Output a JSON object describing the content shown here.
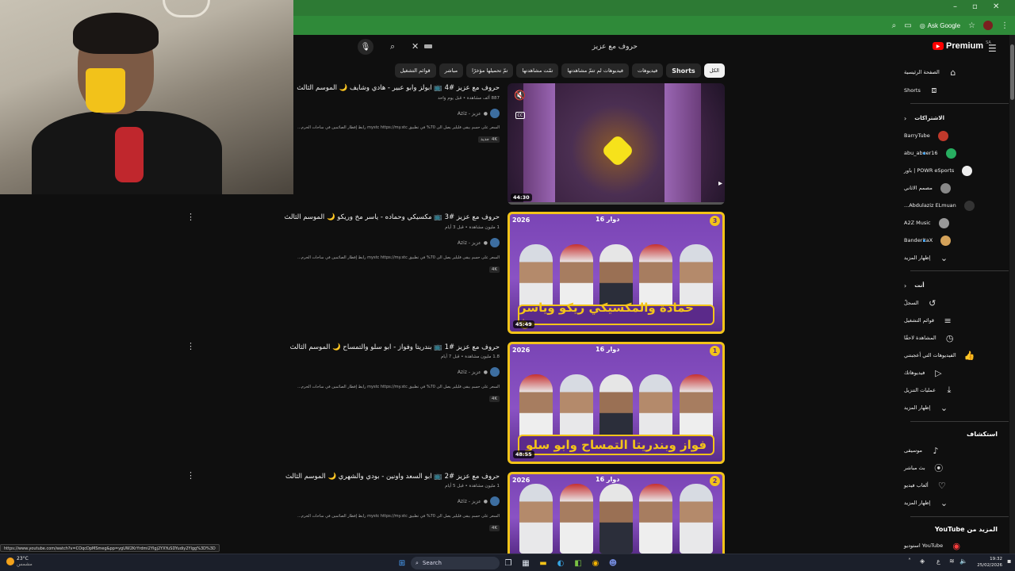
{
  "browser": {
    "ask_google": "Ask Google",
    "window_controls": [
      "–",
      "▫",
      "✕"
    ]
  },
  "search": {
    "query": "حروف مع عزيز"
  },
  "chips": [
    {
      "label": "الكل",
      "active": true
    },
    {
      "label": "Shorts",
      "bold": true
    },
    {
      "label": "فيديوهات"
    },
    {
      "label": "فيديوهات لم تتمّ مشاهدتها"
    },
    {
      "label": "تمّت مشاهدتها"
    },
    {
      "label": "تمّ تحميلها مؤخرًا"
    },
    {
      "label": "مباشر"
    },
    {
      "label": "قوائم التشغيل"
    }
  ],
  "results": [
    {
      "title": "حروف مع عزيز #4 📺 ابولز وابو عبير - هادي وشايف 🌙 الموسم الثالث",
      "meta": "887 ألف مشاهدة • قبل يوم واحد",
      "channel": "Aziz - عزيز",
      "desc": "السعر على حسم يبقى قليلير يصل الى 70% في تطبيق mystc https://my.stc رابط إفطار الصائمين في ساحات الحرم...",
      "badges": [
        "4K",
        "جديد"
      ],
      "duration": "44:30"
    },
    {
      "title": "حروف مع عزيز #3 📺 مكسيكي وحماده - ياسر مخ وريكو 🌙 الموسم الثالث",
      "meta": "1 مليون مشاهدة • قبل 3 أيام",
      "channel": "Aziz - عزيز",
      "desc": "السعر على حسم يبقى قليلير يصل الى 70% في تطبيق mystc https://my.stc رابط إفطار الصائمين في ساحات الحرم...",
      "badges": [
        "4K"
      ],
      "duration": "45:49",
      "banner": "حمادة والمكسيكي  ريكو وياسر مخ",
      "episode": "3",
      "year": "2026",
      "league": "دوار 16"
    },
    {
      "title": "حروف مع عزيز #1 📺 بندريتا وفواز - ابو سلو والتمساح 🌙 الموسم الثالث",
      "meta": "1.8 مليون مشاهدة • قبل 7 أيام",
      "channel": "Aziz - عزيز",
      "desc": "السعر على حسم يبقى قليلير يصل الى 70% في تطبيق mystc https://my.stc رابط إفطار الصائمين في ساحات الحرم...",
      "badges": [
        "4K"
      ],
      "duration": "48:55",
      "banner": "فواز وبندريتا  التمساح وابو سلو",
      "episode": "1",
      "year": "2026",
      "league": "دوار 16"
    },
    {
      "title": "حروف مع عزيز #2 📺 ابو السعد واونين - بودي والشهري 🌙 الموسم الثالث",
      "meta": "1 مليون مشاهدة • قبل 5 أيام",
      "channel": "Aziz - عزيز",
      "desc": "السعر على حسم يبقى قليلير يصل الى 70% في تطبيق mystc https://my.stc رابط إفطار الصائمين في ساحات الحرم...",
      "badges": [
        "4K"
      ],
      "episode": "2",
      "year": "2026",
      "league": "دوار 16"
    }
  ],
  "sidebar": {
    "brand": "Premium",
    "country": "SA",
    "main": [
      {
        "label": "الصفحة الرئيسية",
        "icon": "home-icon"
      },
      {
        "label": "Shorts",
        "icon": "shorts-icon"
      }
    ],
    "subs_header": "الاشتراكات",
    "subs": [
      {
        "label": "BarryTube",
        "color": "#c0392b"
      },
      {
        "label": "abu_abeer16",
        "color": "#27ae60"
      },
      {
        "label": "POWR eSports | باور",
        "color": "#eeeeee"
      },
      {
        "label": "مصمم الاثاني",
        "color": "#888888"
      },
      {
        "label": "Abdulaziz ELmuan...",
        "color": "#333333"
      },
      {
        "label": "A2Z Music",
        "color": "#999999"
      },
      {
        "label": "BanderitaX",
        "color": "#d4a25a"
      }
    ],
    "subs_more": "إظهار المزيد",
    "you_header": "أنت",
    "you": [
      {
        "label": "السجلّ",
        "icon": "history-icon"
      },
      {
        "label": "قوائم التشغيل",
        "icon": "playlists-icon"
      },
      {
        "label": "المشاهدة لاحقًا",
        "icon": "watch-later-icon"
      },
      {
        "label": "الفيديوهات التي أعجبتني",
        "icon": "liked-icon"
      },
      {
        "label": "فيديوهاتك",
        "icon": "your-videos-icon"
      },
      {
        "label": "عمليات التنزيل",
        "icon": "downloads-icon"
      },
      {
        "label": "إظهار المزيد",
        "icon": "chevron-down-icon"
      }
    ],
    "explore_header": "استكشاف",
    "explore": [
      {
        "label": "موسيقى",
        "icon": "music-icon"
      },
      {
        "label": "بث مباشر",
        "icon": "live-icon"
      },
      {
        "label": "ألعاب فيديو",
        "icon": "gaming-icon"
      },
      {
        "label": "إظهار المزيد",
        "icon": "chevron-down-icon"
      }
    ],
    "more_header": "المزيد من YouTube",
    "more": [
      {
        "label": "YouTube استوديو",
        "icon": "studio-icon"
      }
    ]
  },
  "status_url": "https://www.youtube.com/watch?v=COqcDpMSmeg&pp=ygUW2KrYrdmi2Ylgj2YXYuSDYudiy2Ylgg%3D%3D",
  "taskbar": {
    "weather_temp": "23°C",
    "weather_desc": "مشمس",
    "search_label": "Search",
    "time": "19:32",
    "date": "25/02/2026",
    "lang": "ع"
  }
}
